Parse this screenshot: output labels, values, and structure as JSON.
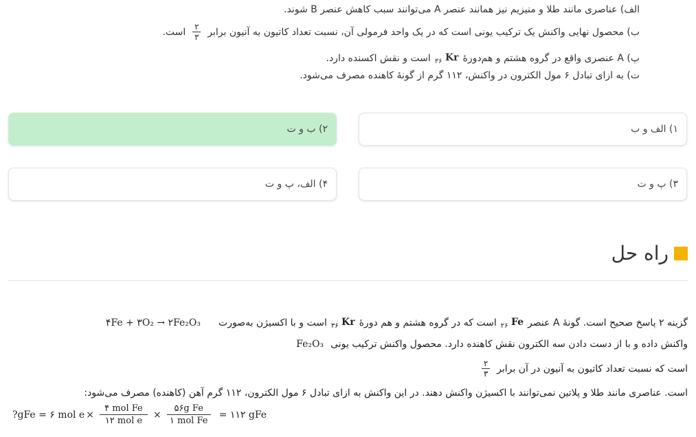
{
  "question": {
    "line_a": "الف) عناصری مانند طلا و منیزیم نیز همانند عنصر A می‌توانند سبب کاهش عنصر B شوند.",
    "line_b_text": "ب) محصول نهایی واکنش یک ترکیب یونی است که در یک واحد فرمولی آن، نسبت تعداد کاتیون به آنیون برابر",
    "line_b_num": "۲",
    "line_b_den": "۳",
    "line_b_end": "است.",
    "line_c_text": "پ) A عنصری واقع در گروه هشتم و هم‌دورهٔ",
    "line_c_sub": "۳۶",
    "line_c_symbol": "Kr",
    "line_c_end": "است و نقش اکسنده دارد.",
    "line_d": "ت) به ازای تبادل ۶ مول الکترون در واکنش، ۱۱۲ گرم از گونهٔ کاهنده مصرف می‌شود."
  },
  "options": [
    {
      "label": "۱) الف و ب",
      "correct": false
    },
    {
      "label": "۲) ب و ت",
      "correct": true
    },
    {
      "label": "۳) پ و ت",
      "correct": false
    },
    {
      "label": "۴) الف، پ و ت",
      "correct": false
    }
  ],
  "solution": {
    "title": "راه حل",
    "l1_a": "گزینه ۲ پاسخ صحیح است. گونهٔ A عنصر",
    "l1_sub1": "۲۶",
    "l1_sym1": "Fe",
    "l1_b": "است که در گروه هشتم و هم دورهٔ",
    "l1_sub2": "۳۶",
    "l1_sym2": "Kr",
    "l1_c": "است و با اکسیژن به‌صورت",
    "l1_eq": "۴Fe + ۳O₂ → ۲Fe₂O₃",
    "l2_a": "واکنش داده و با از دست دادن سه الکترون نقش کاهنده دارد. محصول واکنش ترکیب یونی",
    "l2_formula": "Fe₂O₃",
    "l3_a": "است که نسبت تعداد کاتیون به آنیون در آن برابر",
    "l3_num": "۲",
    "l3_den": "۳",
    "l4": "است. عناصری مانند طلا و پلاتین نمی‌توانند با اکسیژن واکنش دهند. در این واکنش به ازای تبادل ۶ مول الکترون، ۱۱۲ گرم آهن (کاهنده) مصرف می‌شود:",
    "calc_lhs": "?gFe = ۶ mol e",
    "calc_f1_num": "۴ mol Fe",
    "calc_f1_den": "۱۲ mol e",
    "calc_f2_num": "۵۶g Fe",
    "calc_f2_den": "۱ mol Fe",
    "calc_rhs": "= ۱۱۲ gFe"
  },
  "colors": {
    "correct_bg": "#c3eecd",
    "accent": "#f5b200"
  }
}
